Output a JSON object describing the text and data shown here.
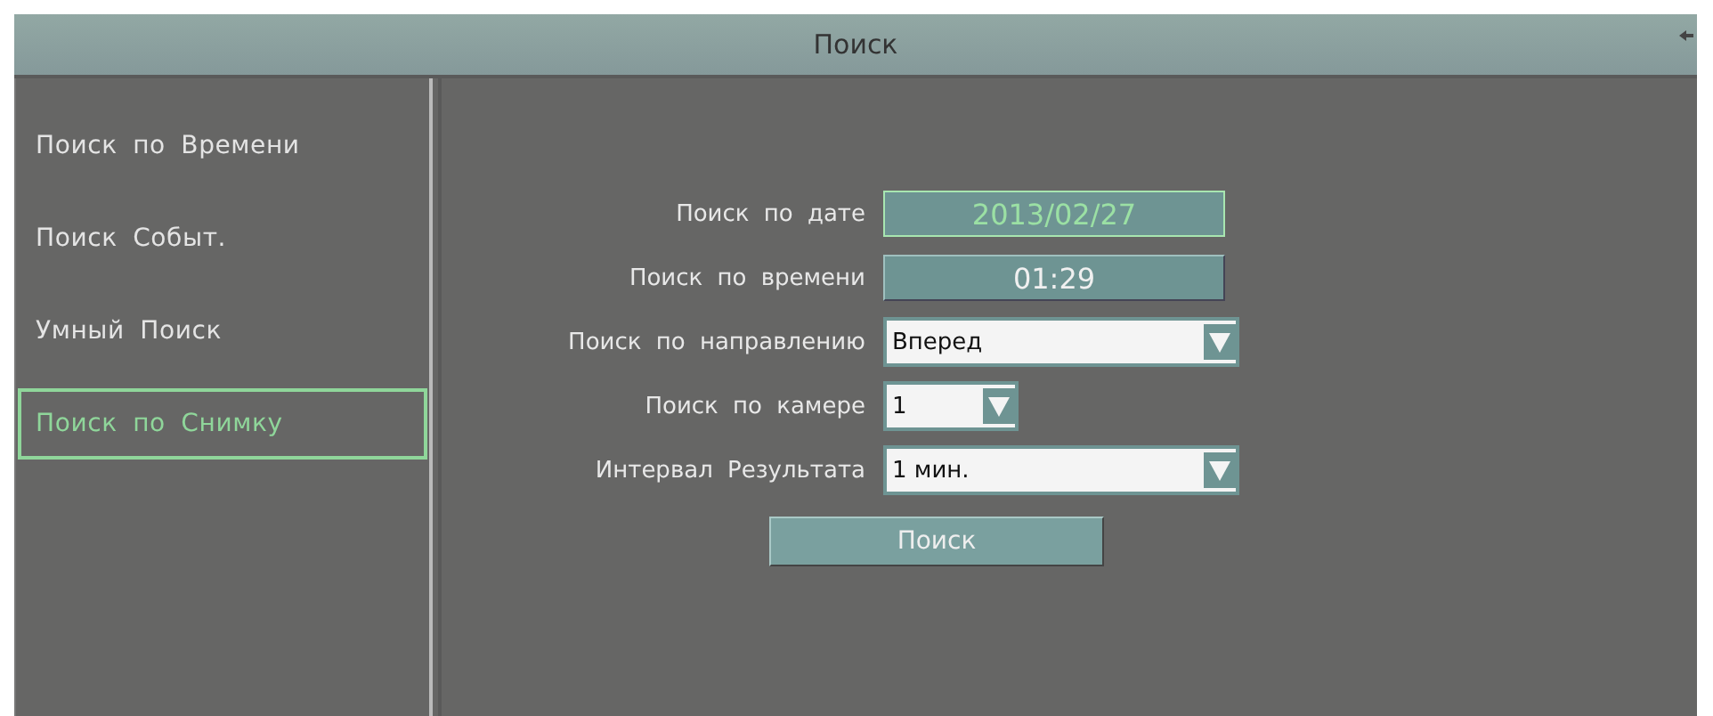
{
  "window": {
    "title": "Поиск"
  },
  "sidebar": {
    "items": [
      {
        "label": "Поиск по Времени",
        "selected": false
      },
      {
        "label": "Поиск Событ.",
        "selected": false
      },
      {
        "label": "Умный Поиск",
        "selected": false
      },
      {
        "label": "Поиск по Снимку",
        "selected": true
      }
    ]
  },
  "form": {
    "fields": [
      {
        "label": "Поиск по дате",
        "kind": "button",
        "value": "2013/02/27",
        "focused": true
      },
      {
        "label": "Поиск по времени",
        "kind": "button",
        "value": "01:29",
        "focused": false
      },
      {
        "label": "Поиск по направлению",
        "kind": "select",
        "value": "Вперед",
        "narrow": false
      },
      {
        "label": "Поиск по камере",
        "kind": "select",
        "value": "1",
        "narrow": true
      },
      {
        "label": "Интервал Результата",
        "kind": "select",
        "value": "1 мин.",
        "narrow": false
      }
    ],
    "submit": "Поиск"
  }
}
